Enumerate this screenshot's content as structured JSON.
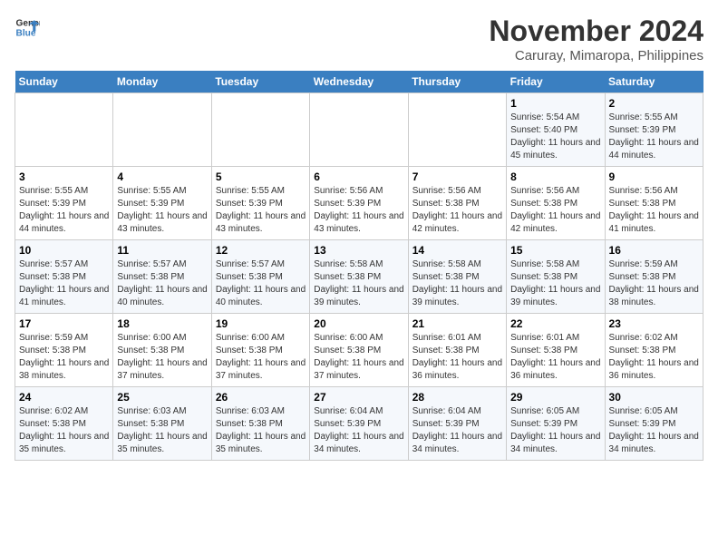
{
  "logo": {
    "text_general": "General",
    "text_blue": "Blue"
  },
  "title": "November 2024",
  "subtitle": "Caruray, Mimaropa, Philippines",
  "days_of_week": [
    "Sunday",
    "Monday",
    "Tuesday",
    "Wednesday",
    "Thursday",
    "Friday",
    "Saturday"
  ],
  "weeks": [
    [
      {
        "day": "",
        "info": ""
      },
      {
        "day": "",
        "info": ""
      },
      {
        "day": "",
        "info": ""
      },
      {
        "day": "",
        "info": ""
      },
      {
        "day": "",
        "info": ""
      },
      {
        "day": "1",
        "info": "Sunrise: 5:54 AM\nSunset: 5:40 PM\nDaylight: 11 hours and 45 minutes."
      },
      {
        "day": "2",
        "info": "Sunrise: 5:55 AM\nSunset: 5:39 PM\nDaylight: 11 hours and 44 minutes."
      }
    ],
    [
      {
        "day": "3",
        "info": "Sunrise: 5:55 AM\nSunset: 5:39 PM\nDaylight: 11 hours and 44 minutes."
      },
      {
        "day": "4",
        "info": "Sunrise: 5:55 AM\nSunset: 5:39 PM\nDaylight: 11 hours and 43 minutes."
      },
      {
        "day": "5",
        "info": "Sunrise: 5:55 AM\nSunset: 5:39 PM\nDaylight: 11 hours and 43 minutes."
      },
      {
        "day": "6",
        "info": "Sunrise: 5:56 AM\nSunset: 5:39 PM\nDaylight: 11 hours and 43 minutes."
      },
      {
        "day": "7",
        "info": "Sunrise: 5:56 AM\nSunset: 5:38 PM\nDaylight: 11 hours and 42 minutes."
      },
      {
        "day": "8",
        "info": "Sunrise: 5:56 AM\nSunset: 5:38 PM\nDaylight: 11 hours and 42 minutes."
      },
      {
        "day": "9",
        "info": "Sunrise: 5:56 AM\nSunset: 5:38 PM\nDaylight: 11 hours and 41 minutes."
      }
    ],
    [
      {
        "day": "10",
        "info": "Sunrise: 5:57 AM\nSunset: 5:38 PM\nDaylight: 11 hours and 41 minutes."
      },
      {
        "day": "11",
        "info": "Sunrise: 5:57 AM\nSunset: 5:38 PM\nDaylight: 11 hours and 40 minutes."
      },
      {
        "day": "12",
        "info": "Sunrise: 5:57 AM\nSunset: 5:38 PM\nDaylight: 11 hours and 40 minutes."
      },
      {
        "day": "13",
        "info": "Sunrise: 5:58 AM\nSunset: 5:38 PM\nDaylight: 11 hours and 39 minutes."
      },
      {
        "day": "14",
        "info": "Sunrise: 5:58 AM\nSunset: 5:38 PM\nDaylight: 11 hours and 39 minutes."
      },
      {
        "day": "15",
        "info": "Sunrise: 5:58 AM\nSunset: 5:38 PM\nDaylight: 11 hours and 39 minutes."
      },
      {
        "day": "16",
        "info": "Sunrise: 5:59 AM\nSunset: 5:38 PM\nDaylight: 11 hours and 38 minutes."
      }
    ],
    [
      {
        "day": "17",
        "info": "Sunrise: 5:59 AM\nSunset: 5:38 PM\nDaylight: 11 hours and 38 minutes."
      },
      {
        "day": "18",
        "info": "Sunrise: 6:00 AM\nSunset: 5:38 PM\nDaylight: 11 hours and 37 minutes."
      },
      {
        "day": "19",
        "info": "Sunrise: 6:00 AM\nSunset: 5:38 PM\nDaylight: 11 hours and 37 minutes."
      },
      {
        "day": "20",
        "info": "Sunrise: 6:00 AM\nSunset: 5:38 PM\nDaylight: 11 hours and 37 minutes."
      },
      {
        "day": "21",
        "info": "Sunrise: 6:01 AM\nSunset: 5:38 PM\nDaylight: 11 hours and 36 minutes."
      },
      {
        "day": "22",
        "info": "Sunrise: 6:01 AM\nSunset: 5:38 PM\nDaylight: 11 hours and 36 minutes."
      },
      {
        "day": "23",
        "info": "Sunrise: 6:02 AM\nSunset: 5:38 PM\nDaylight: 11 hours and 36 minutes."
      }
    ],
    [
      {
        "day": "24",
        "info": "Sunrise: 6:02 AM\nSunset: 5:38 PM\nDaylight: 11 hours and 35 minutes."
      },
      {
        "day": "25",
        "info": "Sunrise: 6:03 AM\nSunset: 5:38 PM\nDaylight: 11 hours and 35 minutes."
      },
      {
        "day": "26",
        "info": "Sunrise: 6:03 AM\nSunset: 5:38 PM\nDaylight: 11 hours and 35 minutes."
      },
      {
        "day": "27",
        "info": "Sunrise: 6:04 AM\nSunset: 5:39 PM\nDaylight: 11 hours and 34 minutes."
      },
      {
        "day": "28",
        "info": "Sunrise: 6:04 AM\nSunset: 5:39 PM\nDaylight: 11 hours and 34 minutes."
      },
      {
        "day": "29",
        "info": "Sunrise: 6:05 AM\nSunset: 5:39 PM\nDaylight: 11 hours and 34 minutes."
      },
      {
        "day": "30",
        "info": "Sunrise: 6:05 AM\nSunset: 5:39 PM\nDaylight: 11 hours and 34 minutes."
      }
    ]
  ]
}
